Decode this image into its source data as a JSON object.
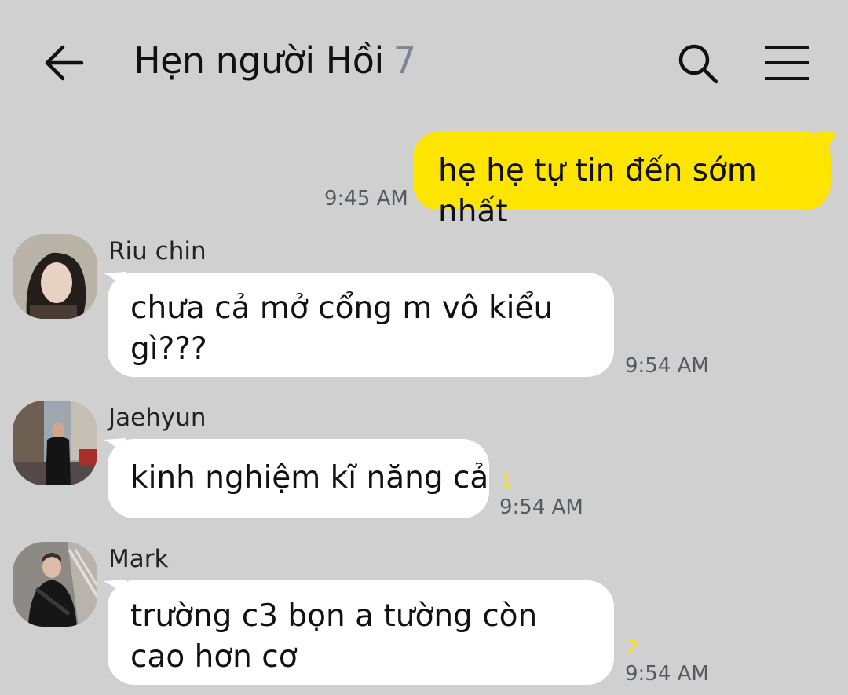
{
  "header": {
    "title": "Hẹn người Hồi",
    "member_count": "7"
  },
  "messages": [
    {
      "direction": "out",
      "text": "hẹ hẹ tự tin đến sớm nhất",
      "time": "9:45 AM"
    },
    {
      "direction": "in",
      "sender": "Riu chin",
      "text": "chưa cả mở cổng m vô kiểu gì???",
      "time": "9:54 AM",
      "unread": ""
    },
    {
      "direction": "in",
      "sender": "Jaehyun",
      "text": "kinh nghiệm kĩ năng cả",
      "time": "9:54 AM",
      "unread": "1"
    },
    {
      "direction": "in",
      "sender": "Mark",
      "text": "trường c3 bọn a tường còn cao hơn cơ",
      "time": "9:54 AM",
      "unread": "2"
    }
  ],
  "colors": {
    "background": "#d0d0d0",
    "outgoing_bubble": "#fee500",
    "incoming_bubble": "#ffffff",
    "unread_count": "#f3df1c",
    "member_count": "#7a8694"
  },
  "icons": [
    "back-arrow-icon",
    "search-icon",
    "menu-icon"
  ]
}
